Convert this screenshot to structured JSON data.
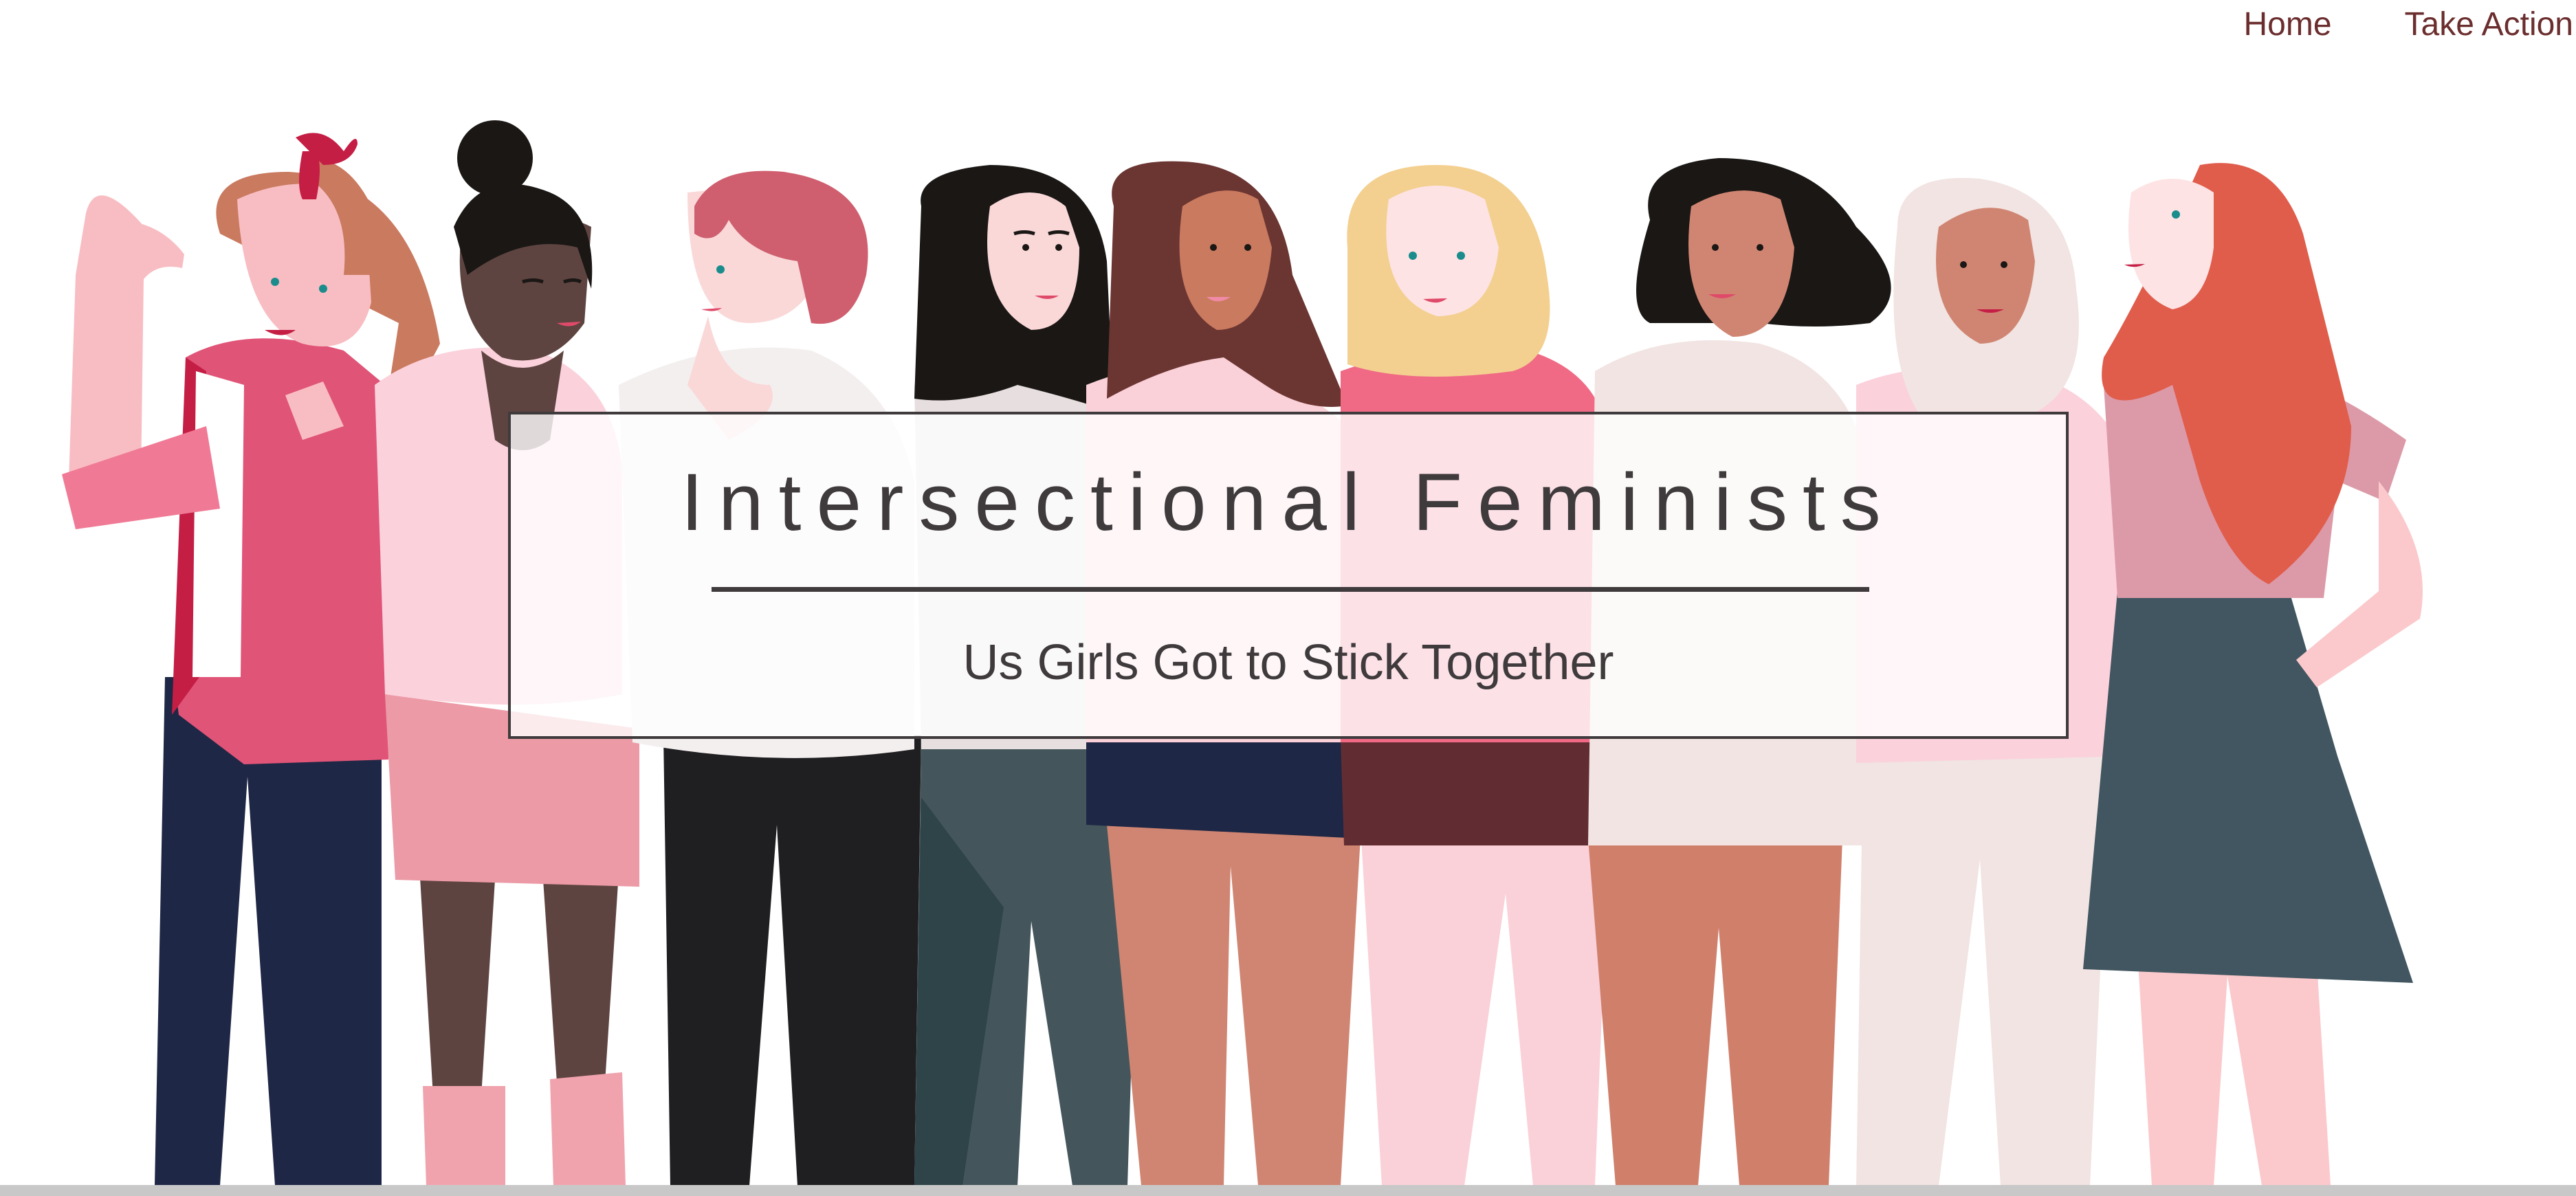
{
  "nav": {
    "home_label": "Home",
    "take_action_label": "Take Action"
  },
  "hero": {
    "title": "Intersectional Feminists",
    "tagline": "Us Girls Got to Stick Together",
    "illustration_icon": "group-of-women-illustration"
  },
  "colors": {
    "nav_text": "#6b2d2d",
    "title_text": "#3f3a3c",
    "box_border": "#3f3a3c",
    "background": "#ffffff"
  }
}
